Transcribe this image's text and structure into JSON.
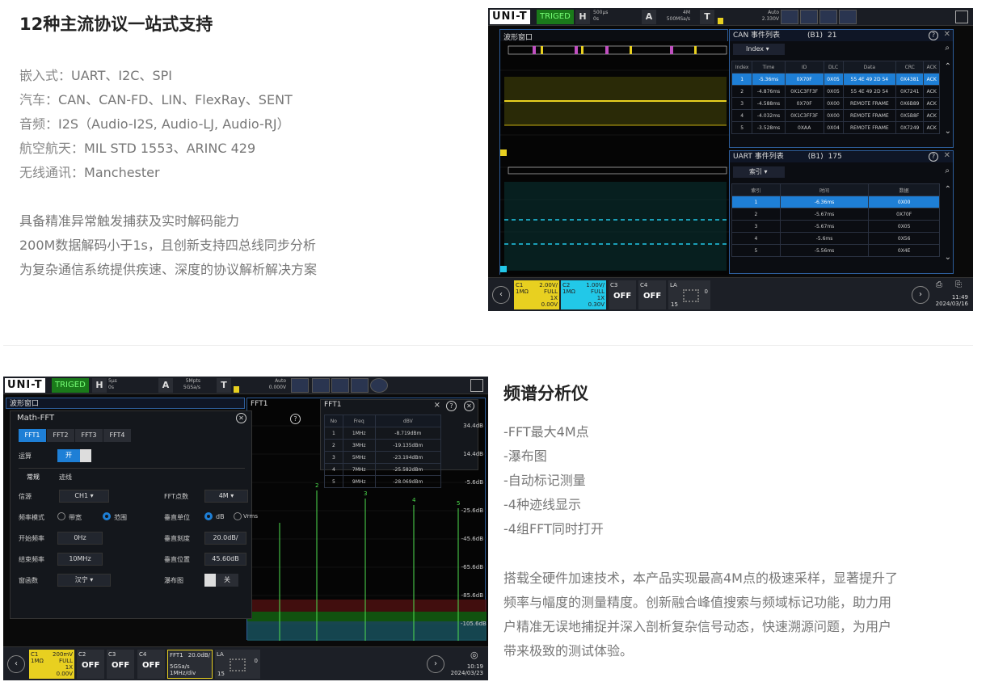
{
  "sec1": {
    "title": "12种主流协议一站式支持",
    "lines": [
      {
        "k": "嵌入式：",
        "v": "UART、I2C、SPI"
      },
      {
        "k": "汽车：",
        "v": "CAN、CAN-FD、LIN、FlexRay、SENT"
      },
      {
        "k": "音频：",
        "v": "I2S（Audio-I2S, Audio-LJ, Audio-RJ）"
      },
      {
        "k": "航空航天：",
        "v": "MIL STD 1553、ARINC 429"
      },
      {
        "k": "无线通讯：",
        "v": "Manchester"
      }
    ],
    "desc": [
      "具备精准异常触发捕获及实时解码能力",
      "200M数据解码小于1s，且创新支持四总线同步分析",
      "为复杂通信系统提供疾速、深度的协议解析解决方案"
    ]
  },
  "sec2": {
    "title": "频谱分析仪",
    "lines": [
      "-FFT最大4M点",
      "-瀑布图",
      "-自动标记测量",
      "-4种迹线显示",
      "-4组FFT同时打开"
    ],
    "desc": [
      "搭载全硬件加速技术，本产品实现最高4M点的极速采样，显著提升了",
      "频率与幅度的测量精度。创新融合峰值搜索与频域标记功能，助力用",
      "户精准无误地捕捉并深入剖析复杂信号动态，快速溯源问题，为用户",
      "带来极致的测试体验。"
    ]
  },
  "scope1": {
    "logo": "UNI-T",
    "trig": "TRIGED",
    "h": "H",
    "hval1": "500μs",
    "hval2": "0s",
    "a": "A",
    "aval1": "4M",
    "aval2": "500MSa/s",
    "t": "T",
    "tval1": "Auto",
    "tval2": "2.330V",
    "wave_title": "波形窗口",
    "can": {
      "title": "CAN 事件列表",
      "bus": "(B1)",
      "count": "21",
      "index_label": "Index",
      "headers": [
        "Index",
        "Time",
        "ID",
        "DLC",
        "Data",
        "CRC",
        "ACK"
      ],
      "rows": [
        [
          "1",
          "-5.36ms",
          "0X70F",
          "0X05",
          "55 4E 49 2D 54",
          "0X4381",
          "ACK"
        ],
        [
          "2",
          "-4.876ms",
          "0X1C3FF3F",
          "0X05",
          "55 4E 49 2D 54",
          "0X7241",
          "ACK"
        ],
        [
          "3",
          "-4.588ms",
          "0X70F",
          "0X00",
          "REMOTE FRAME",
          "0X6B89",
          "ACK"
        ],
        [
          "4",
          "-4.032ms",
          "0X1C3FF3F",
          "0X00",
          "REMOTE FRAME",
          "0X5B8F",
          "ACK"
        ],
        [
          "5",
          "-3.528ms",
          "0XAA",
          "0X04",
          "REMOTE FRAME",
          "0X7249",
          "ACK"
        ]
      ]
    },
    "uart": {
      "title": "UART 事件列表",
      "bus": "(B1)",
      "count": "175",
      "index_label": "索引",
      "headers": [
        "索引",
        "时间",
        "数据"
      ],
      "rows": [
        [
          "1",
          "-6.36ms",
          "0X00"
        ],
        [
          "2",
          "-5.67ms",
          "0X70F"
        ],
        [
          "3",
          "-5.67ms",
          "0X05"
        ],
        [
          "4",
          "-5.6ms",
          "0X56"
        ],
        [
          "5",
          "-5.56ms",
          "0X4E"
        ]
      ]
    },
    "c1": {
      "name": "C1",
      "v": "2.00V/",
      "imp": "1MΩ",
      "bw": "FULL",
      "p": "1X",
      "off": "0.00V"
    },
    "c2": {
      "name": "C2",
      "v": "1.00V/",
      "imp": "1MΩ",
      "bw": "FULL",
      "p": "1X",
      "off": "0.30V"
    },
    "c3": "C3",
    "c4": "C4",
    "la": "LA",
    "off": "OFF",
    "la_num": "15",
    "la_zero": "0",
    "time": "11:49",
    "date": "2024/03/16"
  },
  "scope2": {
    "logo": "UNI-T",
    "trig": "TRIGED",
    "h": "H",
    "hval1": "5μs",
    "hval2": "0s",
    "a": "A",
    "aval1": "5Mpts",
    "aval2": "5GSa/s",
    "t": "T",
    "tval1": "Auto",
    "tval2": "0.000V",
    "wave_title": "波形窗口",
    "fft_tab": "FFT1",
    "math": {
      "title": "Math-FFT",
      "tabs": [
        "FFT1",
        "FFT2",
        "FFT3",
        "FFT4"
      ],
      "op": "运算",
      "on": "开",
      "sub": [
        "常规",
        "迹线"
      ],
      "src_l": "信源",
      "src_v": "CH1",
      "mode_l": "频率模式",
      "mode_a": "带宽",
      "mode_b": "范围",
      "start_l": "开始频率",
      "start_v": "0Hz",
      "end_l": "结束频率",
      "end_v": "10MHz",
      "win_l": "窗函数",
      "win_v": "汉宁",
      "pts_l": "FFT点数",
      "pts_v": "4M",
      "unit_l": "垂直单位",
      "unit_a": "dB",
      "unit_b": "Vrms",
      "scale_l": "垂直刻度",
      "scale_v": "20.0dB/",
      "pos_l": "垂直位置",
      "pos_v": "45.60dB",
      "wf_l": "瀑布图",
      "wf_v": "关"
    },
    "fftt": {
      "title": "FFT1",
      "headers": [
        "No",
        "Freq",
        "dBV"
      ],
      "rows": [
        [
          "1",
          "1MHz",
          "-8.719dBm"
        ],
        [
          "2",
          "3MHz",
          "-19.135dBm"
        ],
        [
          "3",
          "5MHz",
          "-23.194dBm"
        ],
        [
          "4",
          "7MHz",
          "-25.582dBm"
        ],
        [
          "5",
          "9MHz",
          "-28.069dBm"
        ]
      ]
    },
    "ylabels": [
      "34.4dB",
      "14.4dB",
      "-5.6dB",
      "-25.6dB",
      "-45.6dB",
      "-65.6dB",
      "-85.6dB",
      "-105.6dB"
    ],
    "c1": {
      "name": "C1",
      "v": "200mV",
      "imp": "1MΩ",
      "bw": "FULL",
      "p": "1X",
      "off": "0.00V"
    },
    "c2": "C2",
    "c3": "C3",
    "c4": "C4",
    "off": "OFF",
    "fft": {
      "name": "FFT1",
      "v": "20.0dB/",
      "s": "5GSa/s",
      "d": "1MHz/div"
    },
    "la": "LA",
    "la_num": "15",
    "la_zero": "0",
    "time": "10:19",
    "date": "2024/03/23"
  }
}
